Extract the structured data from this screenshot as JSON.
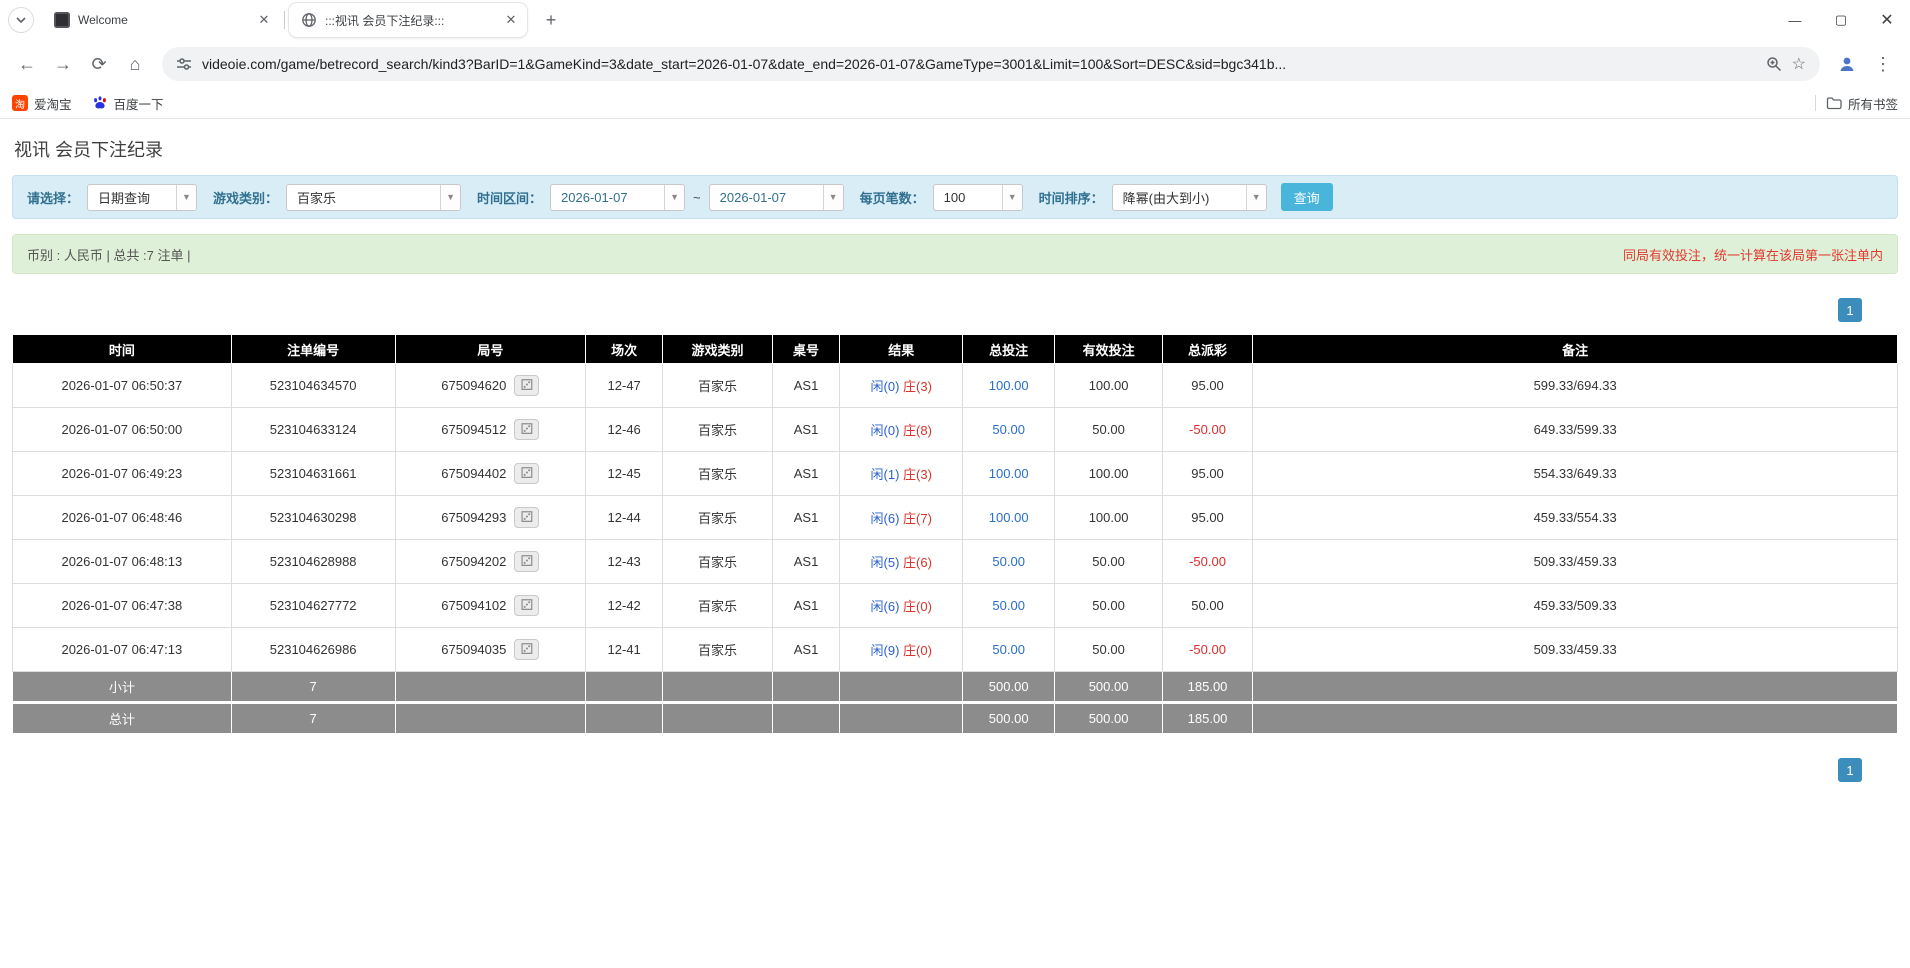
{
  "colors": {
    "accent_blue": "#3c8dbc",
    "search_button_blue": "#4ab5da",
    "filter_bg": "#d9edf7",
    "filter_label_blue": "#31708f",
    "info_bg": "#dff0d8",
    "warning_red": "#e03a2f",
    "table_header_bg": "#000000",
    "table_footer_bg": "#8c8c8c",
    "link_blue": "#2a6fc9",
    "player_blue": "#2a5fce",
    "banker_red": "#d9342b",
    "negative_red": "#e02b2b"
  },
  "browser": {
    "tabs": [
      {
        "title": "Welcome"
      },
      {
        "title": ":::视讯 会员下注纪录:::"
      }
    ],
    "url": "videoie.com/game/betrecord_search/kind3?BarID=1&GameKind=3&date_start=2026-01-07&date_end=2026-01-07&GameType=3001&Limit=100&Sort=DESC&sid=bgc341b...",
    "bookmarks": [
      {
        "label": "爱淘宝"
      },
      {
        "label": "百度一下"
      }
    ],
    "all_bookmarks_label": "所有书签"
  },
  "page": {
    "title": "视讯 会员下注纪录",
    "filters": {
      "select_label": "请选择：",
      "select_value": "日期查询",
      "game_kind_label": "游戏类别：",
      "game_kind_value": "百家乐",
      "date_range_label": "时间区间：",
      "date_start": "2026-01-07",
      "date_separator": "~",
      "date_end": "2026-01-07",
      "per_page_label": "每页笔数：",
      "per_page_value": "100",
      "sort_label": "时间排序：",
      "sort_value": "降幂(由大到小)",
      "search_button": "查询"
    },
    "info_bar": {
      "summary": "币别 : 人民币 | 总共 :7 注单 |",
      "notice": "同局有效投注，统一计算在该局第一张注单内"
    },
    "pagination": {
      "current": "1"
    },
    "table": {
      "headers": [
        "时间",
        "注单编号",
        "局号",
        "场次",
        "游戏类别",
        "桌号",
        "结果",
        "总投注",
        "有效投注",
        "总派彩",
        "备注"
      ],
      "rows": [
        {
          "time": "2026-01-07 06:50:37",
          "bet_id": "523104634570",
          "round": "675094620",
          "session": "12-47",
          "game": "百家乐",
          "table_no": "AS1",
          "result_player": "闲(0)",
          "result_banker": "庄(3)",
          "total_bet": "100.00",
          "valid_bet": "100.00",
          "payout": "95.00",
          "note": "599.33/694.33"
        },
        {
          "time": "2026-01-07 06:50:00",
          "bet_id": "523104633124",
          "round": "675094512",
          "session": "12-46",
          "game": "百家乐",
          "table_no": "AS1",
          "result_player": "闲(0)",
          "result_banker": "庄(8)",
          "total_bet": "50.00",
          "valid_bet": "50.00",
          "payout": "-50.00",
          "note": "649.33/599.33"
        },
        {
          "time": "2026-01-07 06:49:23",
          "bet_id": "523104631661",
          "round": "675094402",
          "session": "12-45",
          "game": "百家乐",
          "table_no": "AS1",
          "result_player": "闲(1)",
          "result_banker": "庄(3)",
          "total_bet": "100.00",
          "valid_bet": "100.00",
          "payout": "95.00",
          "note": "554.33/649.33"
        },
        {
          "time": "2026-01-07 06:48:46",
          "bet_id": "523104630298",
          "round": "675094293",
          "session": "12-44",
          "game": "百家乐",
          "table_no": "AS1",
          "result_player": "闲(6)",
          "result_banker": "庄(7)",
          "total_bet": "100.00",
          "valid_bet": "100.00",
          "payout": "95.00",
          "note": "459.33/554.33"
        },
        {
          "time": "2026-01-07 06:48:13",
          "bet_id": "523104628988",
          "round": "675094202",
          "session": "12-43",
          "game": "百家乐",
          "table_no": "AS1",
          "result_player": "闲(5)",
          "result_banker": "庄(6)",
          "total_bet": "50.00",
          "valid_bet": "50.00",
          "payout": "-50.00",
          "note": "509.33/459.33"
        },
        {
          "time": "2026-01-07 06:47:38",
          "bet_id": "523104627772",
          "round": "675094102",
          "session": "12-42",
          "game": "百家乐",
          "table_no": "AS1",
          "result_player": "闲(6)",
          "result_banker": "庄(0)",
          "total_bet": "50.00",
          "valid_bet": "50.00",
          "payout": "50.00",
          "note": "459.33/509.33"
        },
        {
          "time": "2026-01-07 06:47:13",
          "bet_id": "523104626986",
          "round": "675094035",
          "session": "12-41",
          "game": "百家乐",
          "table_no": "AS1",
          "result_player": "闲(9)",
          "result_banker": "庄(0)",
          "total_bet": "50.00",
          "valid_bet": "50.00",
          "payout": "-50.00",
          "note": "509.33/459.33"
        }
      ],
      "subtotal": {
        "label": "小计",
        "count": "7",
        "total_bet": "500.00",
        "valid_bet": "500.00",
        "payout": "185.00"
      },
      "total": {
        "label": "总计",
        "count": "7",
        "total_bet": "500.00",
        "valid_bet": "500.00",
        "payout": "185.00"
      }
    }
  }
}
